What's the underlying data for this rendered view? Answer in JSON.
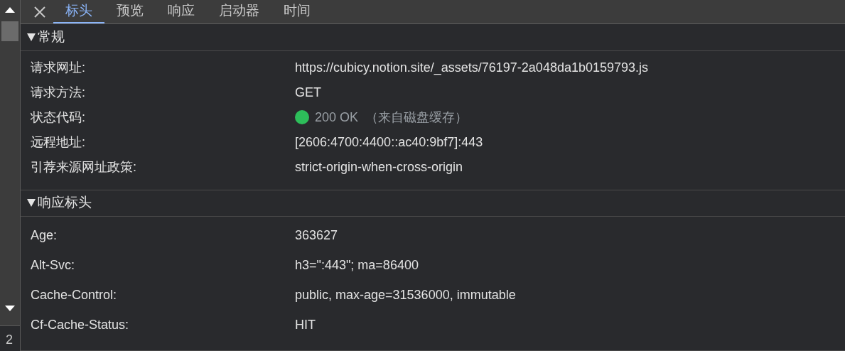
{
  "side_text": "2",
  "tabs": [
    {
      "label": "标头",
      "selected": true
    },
    {
      "label": "预览",
      "selected": false
    },
    {
      "label": "响应",
      "selected": false
    },
    {
      "label": "启动器",
      "selected": false
    },
    {
      "label": "时间",
      "selected": false
    }
  ],
  "sections": [
    {
      "title": "常规",
      "expanded": true,
      "rows": [
        {
          "kind": "text",
          "key": "请求网址:",
          "value": "https://cubicy.notion.site/_assets/76197-2a048da1b0159793.js"
        },
        {
          "kind": "text",
          "key": "请求方法:",
          "value": "GET"
        },
        {
          "kind": "status",
          "key": "状态代码:",
          "value": "200 OK",
          "note": "（来自磁盘缓存）",
          "color": "#2dbe5a"
        },
        {
          "kind": "text",
          "key": "远程地址:",
          "value": "[2606:4700:4400::ac40:9bf7]:443"
        },
        {
          "kind": "text",
          "key": "引荐来源网址政策:",
          "value": "strict-origin-when-cross-origin"
        }
      ]
    },
    {
      "title": "响应标头",
      "expanded": true,
      "rows": [
        {
          "kind": "text",
          "key": "Age:",
          "value": "363627"
        },
        {
          "kind": "text",
          "key": "Alt-Svc:",
          "value": "h3=\":443\"; ma=86400"
        },
        {
          "kind": "text",
          "key": "Cache-Control:",
          "value": "public, max-age=31536000, immutable"
        },
        {
          "kind": "text",
          "key": "Cf-Cache-Status:",
          "value": "HIT"
        }
      ]
    }
  ]
}
